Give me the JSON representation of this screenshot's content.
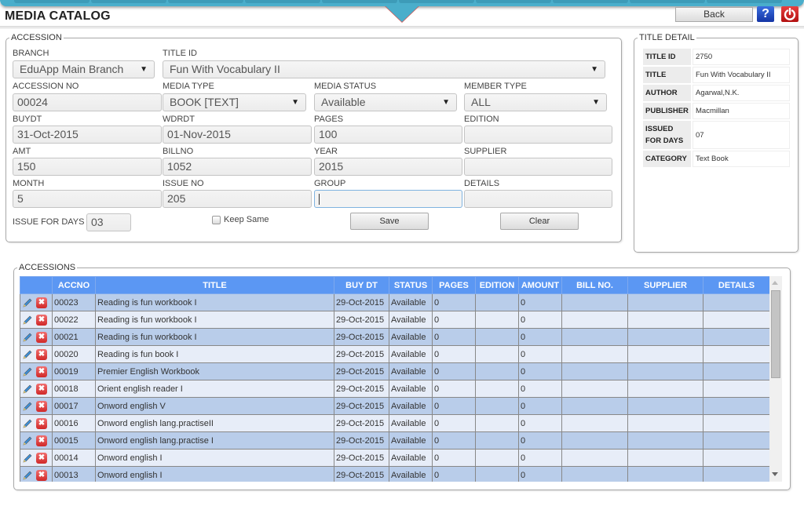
{
  "page": {
    "title": "MEDIA CATALOG"
  },
  "header": {
    "back_label": "Back",
    "help_icon": "help-question-icon",
    "help_glyph": "?",
    "power_icon": "power-logout-icon"
  },
  "accession": {
    "legend": "ACCESSION",
    "branch": {
      "label": "BRANCH",
      "value": "EduApp Main Branch"
    },
    "title_id": {
      "label": "TITLE ID",
      "value": "Fun With Vocabulary II"
    },
    "accession_no": {
      "label": "ACCESSION NO",
      "value": "00024"
    },
    "media_type": {
      "label": "MEDIA TYPE",
      "value": "BOOK [TEXT]"
    },
    "media_status": {
      "label": "MEDIA STATUS",
      "value": "Available"
    },
    "member_type": {
      "label": "MEMBER TYPE",
      "value": "ALL"
    },
    "buydt": {
      "label": "BUYDT",
      "value": "31-Oct-2015"
    },
    "wdrdt": {
      "label": "WDRDT",
      "value": "01-Nov-2015"
    },
    "pages": {
      "label": "PAGES",
      "value": "100"
    },
    "edition": {
      "label": "EDITION",
      "value": ""
    },
    "amt": {
      "label": "AMT",
      "value": "150"
    },
    "billno": {
      "label": "BILLNO",
      "value": "1052"
    },
    "year": {
      "label": "YEAR",
      "value": "2015"
    },
    "supplier": {
      "label": "SUPPLIER",
      "value": ""
    },
    "month": {
      "label": "MONTH",
      "value": "5"
    },
    "issue_no": {
      "label": "ISSUE NO",
      "value": "205"
    },
    "group": {
      "label": "GROUP",
      "value": ""
    },
    "details": {
      "label": "DETAILS",
      "value": ""
    },
    "issue_for_days": {
      "label": "ISSUE FOR DAYS",
      "value": "03"
    },
    "keep_same_label": "Keep Same",
    "keep_same_checked": false,
    "save_label": "Save",
    "clear_label": "Clear",
    "caret": "▼"
  },
  "title_detail": {
    "legend": "TITLE DETAIL",
    "rows": [
      {
        "key": "TITLE ID",
        "value": "2750"
      },
      {
        "key": "TITLE",
        "value": "Fun With Vocabulary II"
      },
      {
        "key": "AUTHOR",
        "value": "Agarwal,N.K."
      },
      {
        "key": "PUBLISHER",
        "value": "Macmillan"
      },
      {
        "key": "ISSUED FOR DAYS",
        "value": "07"
      },
      {
        "key": "CATEGORY",
        "value": "Text Book"
      }
    ]
  },
  "accessions": {
    "legend": "ACCESSIONS",
    "columns": [
      "",
      "ACCNO",
      "TITLE",
      "BUY DT",
      "STATUS",
      "PAGES",
      "EDITION",
      "AMOUNT",
      "BILL NO.",
      "SUPPLIER",
      "DETAILS"
    ],
    "rows": [
      {
        "accno": "00023",
        "title": "Reading is fun workbook I",
        "buy_dt": "29-Oct-2015",
        "status": "Available",
        "pages": "0",
        "edition": "",
        "amount": "0",
        "bill_no": "",
        "supplier": "",
        "details": ""
      },
      {
        "accno": "00022",
        "title": "Reading is fun workbook I",
        "buy_dt": "29-Oct-2015",
        "status": "Available",
        "pages": "0",
        "edition": "",
        "amount": "0",
        "bill_no": "",
        "supplier": "",
        "details": ""
      },
      {
        "accno": "00021",
        "title": "Reading is fun workbook I",
        "buy_dt": "29-Oct-2015",
        "status": "Available",
        "pages": "0",
        "edition": "",
        "amount": "0",
        "bill_no": "",
        "supplier": "",
        "details": ""
      },
      {
        "accno": "00020",
        "title": "Reading is fun book I",
        "buy_dt": "29-Oct-2015",
        "status": "Available",
        "pages": "0",
        "edition": "",
        "amount": "0",
        "bill_no": "",
        "supplier": "",
        "details": ""
      },
      {
        "accno": "00019",
        "title": "Premier English Workbook",
        "buy_dt": "29-Oct-2015",
        "status": "Available",
        "pages": "0",
        "edition": "",
        "amount": "0",
        "bill_no": "",
        "supplier": "",
        "details": ""
      },
      {
        "accno": "00018",
        "title": "Orient english reader I",
        "buy_dt": "29-Oct-2015",
        "status": "Available",
        "pages": "0",
        "edition": "",
        "amount": "0",
        "bill_no": "",
        "supplier": "",
        "details": ""
      },
      {
        "accno": "00017",
        "title": "Onword english V",
        "buy_dt": "29-Oct-2015",
        "status": "Available",
        "pages": "0",
        "edition": "",
        "amount": "0",
        "bill_no": "",
        "supplier": "",
        "details": ""
      },
      {
        "accno": "00016",
        "title": "Onword english lang.practiseII",
        "buy_dt": "29-Oct-2015",
        "status": "Available",
        "pages": "0",
        "edition": "",
        "amount": "0",
        "bill_no": "",
        "supplier": "",
        "details": ""
      },
      {
        "accno": "00015",
        "title": "Onword english lang.practise I",
        "buy_dt": "29-Oct-2015",
        "status": "Available",
        "pages": "0",
        "edition": "",
        "amount": "0",
        "bill_no": "",
        "supplier": "",
        "details": ""
      },
      {
        "accno": "00014",
        "title": "Onword english I",
        "buy_dt": "29-Oct-2015",
        "status": "Available",
        "pages": "0",
        "edition": "",
        "amount": "0",
        "bill_no": "",
        "supplier": "",
        "details": ""
      },
      {
        "accno": "00013",
        "title": "Onword english I",
        "buy_dt": "29-Oct-2015",
        "status": "Available",
        "pages": "0",
        "edition": "",
        "amount": "0",
        "bill_no": "",
        "supplier": "",
        "details": ""
      }
    ],
    "edit_icon": "pencil-edit-icon",
    "delete_icon": "delete-x-icon",
    "delete_glyph": "✖"
  },
  "colors": {
    "nav_bar": "#4aaecb",
    "grid_header": "#5b97f3",
    "row_odd": "#b9cdea",
    "row_even": "#e7edf8",
    "help_blue": "#1f4bc4",
    "power_red": "#d32020"
  }
}
